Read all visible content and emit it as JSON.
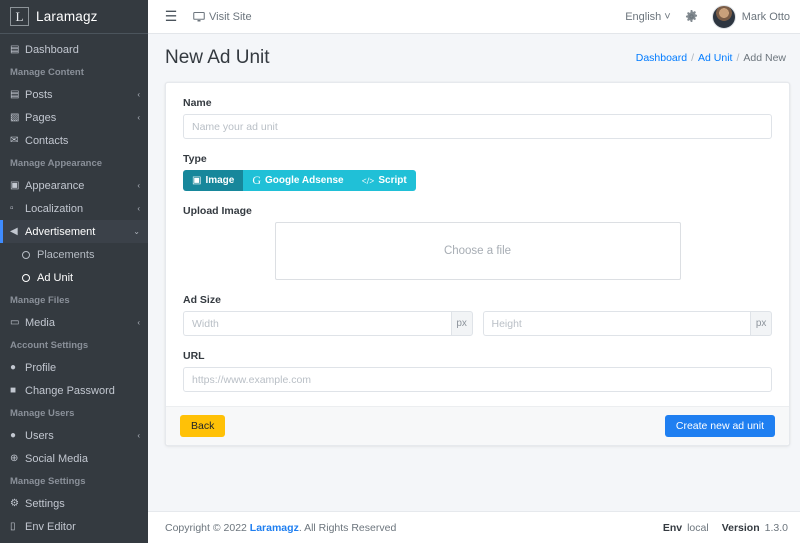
{
  "brand": {
    "logo_letter": "L",
    "name": "Laramagz"
  },
  "sidebar": {
    "sections": [
      {
        "type": "item",
        "icon": "dashboard-icon",
        "label": "Dashboard",
        "chevron": ""
      },
      {
        "type": "header",
        "label": "Manage Content"
      },
      {
        "type": "item",
        "icon": "posts-icon",
        "label": "Posts",
        "chevron": "‹"
      },
      {
        "type": "item",
        "icon": "pages-icon",
        "label": "Pages",
        "chevron": "‹"
      },
      {
        "type": "item",
        "icon": "contacts-icon",
        "label": "Contacts",
        "chevron": ""
      },
      {
        "type": "header",
        "label": "Manage Appearance"
      },
      {
        "type": "item",
        "icon": "appearance-icon",
        "label": "Appearance",
        "chevron": "‹"
      },
      {
        "type": "item",
        "icon": "localization-icon",
        "label": "Localization",
        "chevron": "‹"
      },
      {
        "type": "open",
        "icon": "advertisement-icon",
        "label": "Advertisement",
        "chevron": "⌄"
      },
      {
        "type": "sub",
        "icon": "circle-icon",
        "label": "Placements",
        "active": false
      },
      {
        "type": "sub",
        "icon": "circle-icon",
        "label": "Ad Unit",
        "active": true
      },
      {
        "type": "header",
        "label": "Manage Files"
      },
      {
        "type": "item",
        "icon": "media-icon",
        "label": "Media",
        "chevron": "‹"
      },
      {
        "type": "header",
        "label": "Account Settings"
      },
      {
        "type": "item",
        "icon": "profile-icon",
        "label": "Profile",
        "chevron": ""
      },
      {
        "type": "item",
        "icon": "lock-icon",
        "label": "Change Password",
        "chevron": ""
      },
      {
        "type": "header",
        "label": "Manage Users"
      },
      {
        "type": "item",
        "icon": "users-icon",
        "label": "Users",
        "chevron": "‹"
      },
      {
        "type": "item",
        "icon": "globe-icon",
        "label": "Social Media",
        "chevron": ""
      },
      {
        "type": "header",
        "label": "Manage Settings"
      },
      {
        "type": "item",
        "icon": "settings-gear-icon",
        "label": "Settings",
        "chevron": ""
      },
      {
        "type": "item",
        "icon": "file-icon",
        "label": "Env Editor",
        "chevron": ""
      }
    ]
  },
  "topbar": {
    "menu_toggle_icon": "hamburger-icon",
    "visit_site_label": "Visit Site",
    "visit_site_icon": "monitor-icon",
    "language_label": "English",
    "language_caret": "˅",
    "settings_icon": "gear-icon",
    "user_name": "Mark Otto"
  },
  "page": {
    "title": "New Ad Unit",
    "breadcrumb": [
      {
        "label": "Dashboard",
        "link": true
      },
      {
        "label": "Ad Unit",
        "link": true
      },
      {
        "label": "Add New",
        "link": false
      }
    ],
    "breadcrumb_separator": "/"
  },
  "form": {
    "name": {
      "label": "Name",
      "placeholder": "Name your ad unit",
      "value": ""
    },
    "type": {
      "label": "Type",
      "options": [
        {
          "label": "Image",
          "icon": "image-icon",
          "active": true
        },
        {
          "label": "Google Adsense",
          "icon": "google-icon",
          "active": false
        },
        {
          "label": "Script",
          "icon": "code-icon",
          "active": false
        }
      ]
    },
    "upload": {
      "label": "Upload Image",
      "placeholder": "Choose a file"
    },
    "ad_size": {
      "label": "Ad Size",
      "width": {
        "placeholder": "Width",
        "value": "",
        "unit": "px"
      },
      "height": {
        "placeholder": "Height",
        "value": "",
        "unit": "px"
      }
    },
    "url": {
      "label": "URL",
      "placeholder": "https://www.example.com",
      "value": ""
    },
    "actions": {
      "back_label": "Back",
      "submit_label": "Create new ad unit"
    }
  },
  "footer": {
    "copyright_prefix": "Copyright © 2022",
    "brand": "Laramagz",
    "copyright_suffix": ". All Rights Reserved",
    "env_label": "Env",
    "env_value": "local",
    "version_label": "Version",
    "version_value": "1.3.0"
  },
  "colors": {
    "sidebar_bg": "#343a40",
    "accent_teal": "#20c0d7",
    "accent_teal_active": "#17879b",
    "primary_blue": "#1f7ff1",
    "warning_yellow": "#ffc107",
    "link_blue": "#007bff"
  }
}
